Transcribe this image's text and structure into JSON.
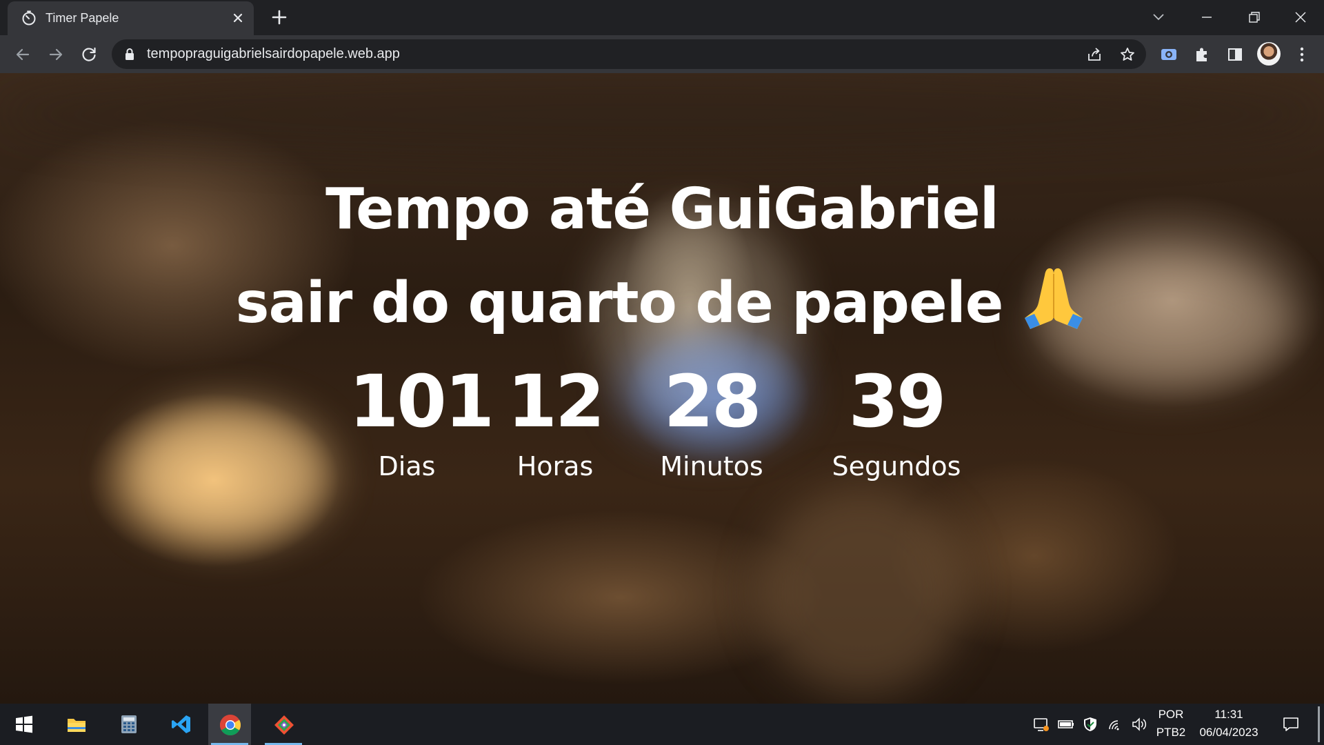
{
  "browser": {
    "tab_title": "Timer Papele",
    "url": "tempopraguigabrielsairdopapele.web.app"
  },
  "page": {
    "headline_line1": "Tempo até GuiGabriel",
    "headline_line2": "sair do quarto de papele",
    "headline_emoji": "folded-hands",
    "countdown": [
      {
        "value": "101",
        "unit": "Dias"
      },
      {
        "value": "12",
        "unit": "Horas"
      },
      {
        "value": "28",
        "unit": "Minutos"
      },
      {
        "value": "39",
        "unit": "Segundos"
      }
    ]
  },
  "taskbar": {
    "apps": [
      "start-icon",
      "file-explorer-icon",
      "calculator-icon",
      "vscode-icon",
      "chrome-icon",
      "git-icon"
    ],
    "lang_top": "POR",
    "lang_bottom": "PTB2",
    "time": "11:31",
    "date": "06/04/2023"
  },
  "colors": {
    "tab_bg": "#35363a",
    "frame_bg": "#202124",
    "taskbar_bg": "#1b1d22",
    "active_underline": "#76b9ed"
  }
}
